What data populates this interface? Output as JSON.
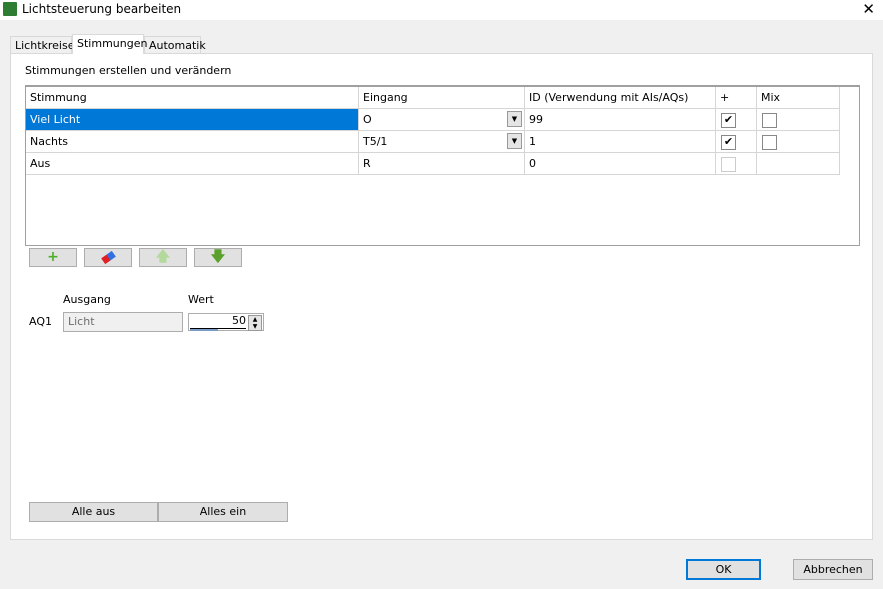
{
  "window": {
    "title": "Lichtsteuerung bearbeiten"
  },
  "tabs": [
    {
      "label": "Lichtkreise"
    },
    {
      "label": "Stimmungen"
    },
    {
      "label": "Automatik"
    }
  ],
  "section_title": "Stimmungen erstellen und verändern",
  "table": {
    "headers": [
      "Stimmung",
      "Eingang",
      "ID (Verwendung mit AIs/AQs)",
      "+",
      "Mix"
    ],
    "rows": [
      {
        "stimmung": "Viel Licht",
        "eingang": "O",
        "id": "99",
        "plus": true,
        "mix": false,
        "selected": true
      },
      {
        "stimmung": "Nachts",
        "eingang": "T5/1",
        "id": "1",
        "plus": true,
        "mix": false
      },
      {
        "stimmung": "Aus",
        "eingang": "R",
        "id": "0",
        "plus": false,
        "mix": null
      }
    ]
  },
  "toolbar": {
    "add": "+",
    "up": "🡅",
    "down": "🡇"
  },
  "output": {
    "ausgang_label": "Ausgang",
    "wert_label": "Wert",
    "name": "AQ1",
    "ausgang_value": "Licht",
    "wert_value": "50",
    "wert_percent": 50
  },
  "buttons": {
    "alle_aus": "Alle aus",
    "alles_ein": "Alles ein",
    "ok": "OK",
    "abbrechen": "Abbrechen"
  }
}
